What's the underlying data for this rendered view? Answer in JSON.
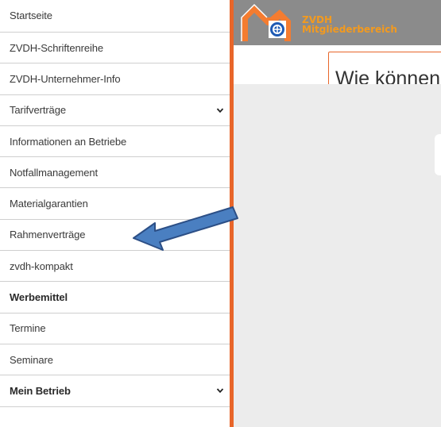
{
  "sidebar": {
    "items": [
      {
        "label": "Startseite"
      },
      {
        "label": "ZVDH-Schriftenreihe"
      },
      {
        "label": "ZVDH-Unternehmer-Info"
      },
      {
        "label": "Tarifverträge",
        "expandable": true
      },
      {
        "label": "Informationen an Betriebe"
      },
      {
        "label": "Notfallmanagement"
      },
      {
        "label": "Materialgarantien"
      },
      {
        "label": "Rahmenverträge"
      },
      {
        "label": "zvdh-kompakt"
      },
      {
        "label": "Werbemittel",
        "bold": true
      },
      {
        "label": "Termine"
      },
      {
        "label": "Seminare"
      },
      {
        "label": "Mein Betrieb",
        "bold": true,
        "expandable": true
      }
    ],
    "chevron_icon": "chevron-down-icon"
  },
  "header": {
    "logo": {
      "line1": "ZVDH",
      "line2": "Mitgliederbereich"
    },
    "search": {
      "placeholder": "Wie können"
    }
  },
  "annotation": {
    "arrow_icon": "arrow-left-icon",
    "arrow_color": "#4a7fc1"
  },
  "colors": {
    "accent": "#e8662a",
    "logo_text": "#f39a1e",
    "header_bg": "#8b8b8b",
    "content_bg": "#ececec"
  }
}
